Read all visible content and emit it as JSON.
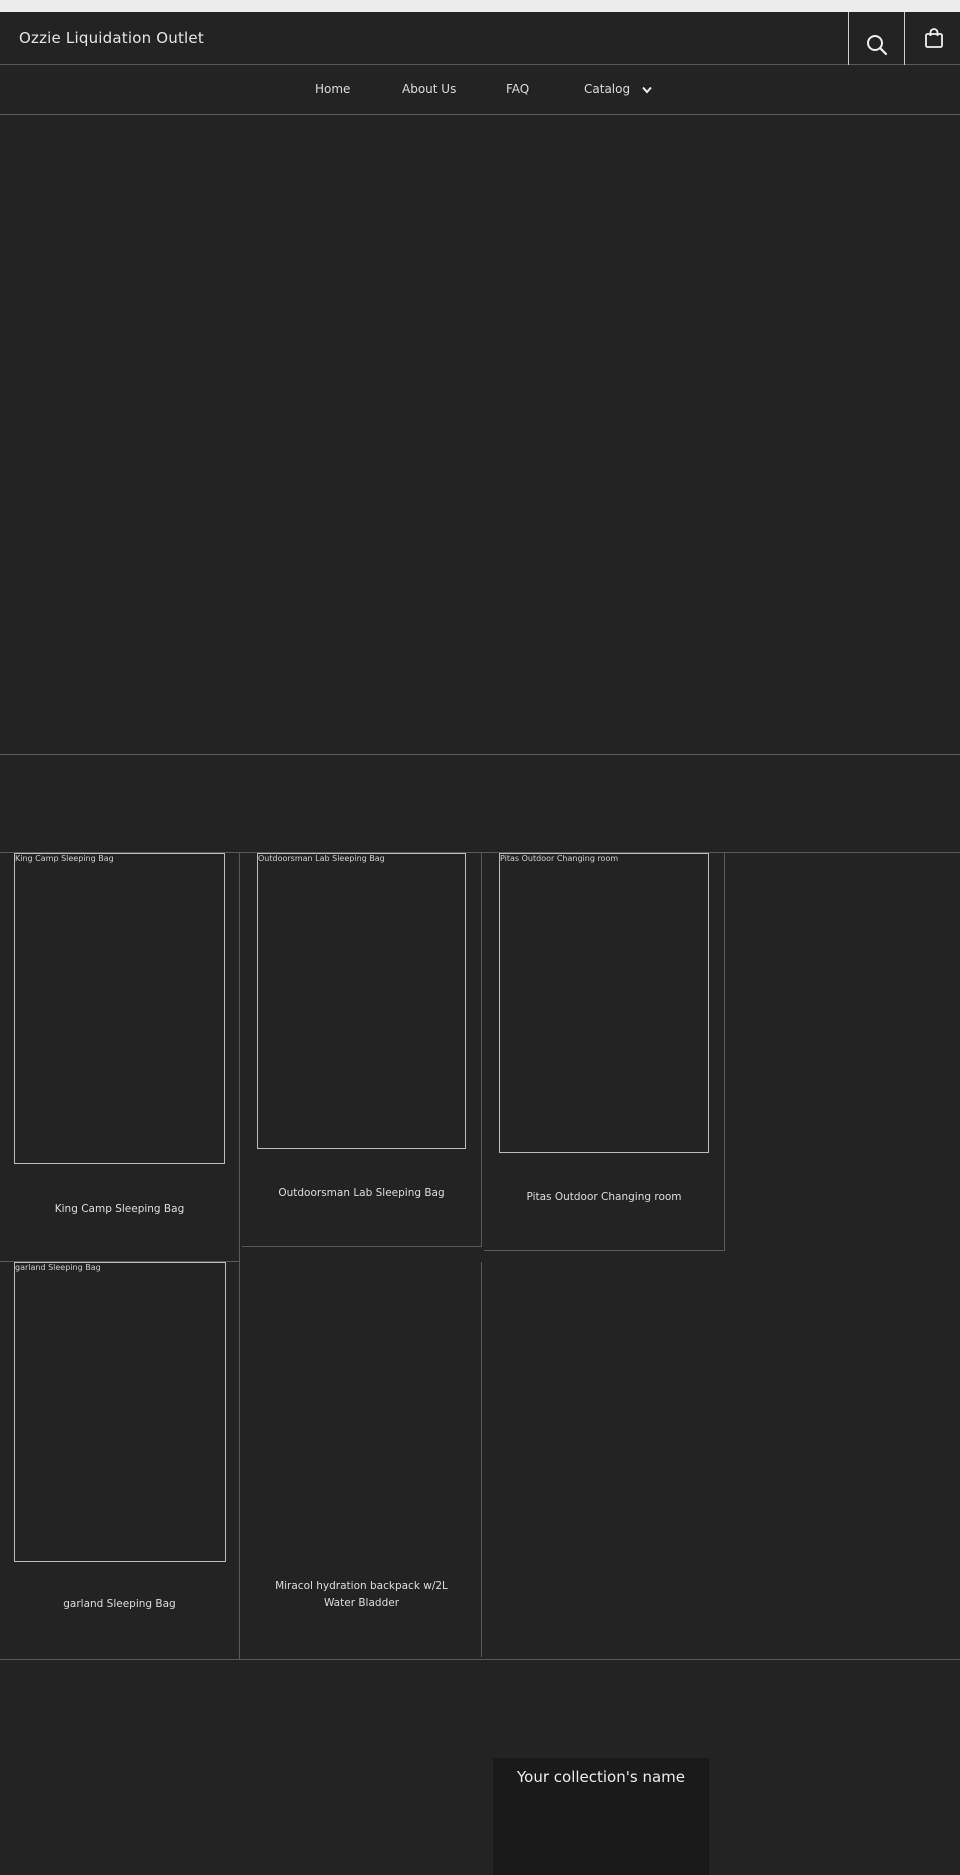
{
  "header": {
    "store_name": "Ozzie Liquidation Outlet",
    "search_icon": "search-icon",
    "cart_icon": "shopping-bag-icon"
  },
  "nav": {
    "items": [
      {
        "label": "Home"
      },
      {
        "label": "About Us"
      },
      {
        "label": "FAQ"
      },
      {
        "label": "Catalog",
        "icon": "chevron-down-icon"
      }
    ]
  },
  "products": [
    {
      "title": "King Camp Sleeping Bag",
      "image_alt": "King Camp Sleeping Bag"
    },
    {
      "title": "Outdoorsman Lab Sleeping Bag",
      "image_alt": "Outdoorsman Lab Sleeping Bag"
    },
    {
      "title": "Pitas Outdoor Changing room",
      "image_alt": "Pitas Outdoor Changing room"
    },
    {
      "title": "garland Sleeping Bag",
      "image_alt": "garland Sleeping Bag"
    },
    {
      "title": "Miracol hydration backpack w/2L Water Bladder"
    }
  ],
  "collection": {
    "title": "Your collection's name"
  },
  "colors": {
    "background": "#232323",
    "text": "#d8d8d8",
    "border": "#5a5a5a",
    "top_strip": "#ececec",
    "collection_tile": "#1a1a1a"
  }
}
